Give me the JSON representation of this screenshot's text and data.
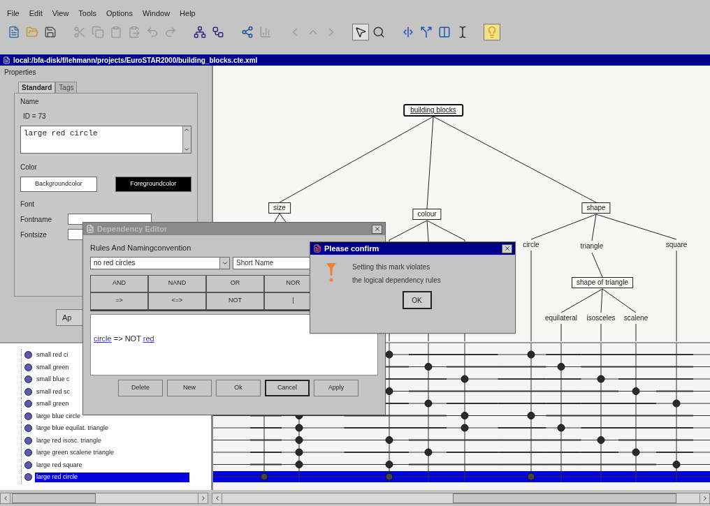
{
  "menu": [
    "File",
    "Edit",
    "View",
    "Tools",
    "Options",
    "Window",
    "Help"
  ],
  "toolbar": [
    [
      {
        "kind": "new",
        "disabled": false,
        "pressed": false
      },
      {
        "kind": "open",
        "disabled": false,
        "pressed": false
      },
      {
        "kind": "save",
        "disabled": false,
        "pressed": false
      }
    ],
    [
      {
        "kind": "cut",
        "disabled": true,
        "pressed": false
      },
      {
        "kind": "copy",
        "disabled": true,
        "pressed": false
      },
      {
        "kind": "paste",
        "disabled": true,
        "pressed": false
      },
      {
        "kind": "paste_special",
        "disabled": true,
        "pressed": false
      },
      {
        "kind": "undo",
        "disabled": true,
        "pressed": false
      },
      {
        "kind": "redo",
        "disabled": true,
        "pressed": false
      }
    ],
    [
      {
        "kind": "tree",
        "disabled": false,
        "pressed": false
      },
      {
        "kind": "tree_outline",
        "disabled": false,
        "pressed": false
      }
    ],
    [
      {
        "kind": "network",
        "disabled": false,
        "pressed": false
      },
      {
        "kind": "chart",
        "disabled": true,
        "pressed": false
      }
    ],
    [
      {
        "kind": "back",
        "disabled": true,
        "pressed": false
      },
      {
        "kind": "up",
        "disabled": true,
        "pressed": false
      },
      {
        "kind": "forward",
        "disabled": true,
        "pressed": false
      }
    ],
    [
      {
        "kind": "pointer",
        "disabled": false,
        "pressed": true
      },
      {
        "kind": "zoom",
        "disabled": false,
        "pressed": false
      }
    ],
    [
      {
        "kind": "h_split",
        "disabled": false,
        "pressed": false
      },
      {
        "kind": "h_split_outline",
        "disabled": false,
        "pressed": false
      },
      {
        "kind": "h_join",
        "disabled": false,
        "pressed": false
      },
      {
        "kind": "text_cursor",
        "disabled": false,
        "pressed": false
      }
    ],
    [
      {
        "kind": "bulb",
        "disabled": false,
        "pressed": true
      }
    ]
  ],
  "document": {
    "title": "local:/bfa-disk/f/lehmann/projects/EuroSTAR2000/building_blocks.cte.xml"
  },
  "properties": {
    "title": "Properties",
    "tabs": [
      {
        "label": "Standard",
        "selected": true
      },
      {
        "label": "Tags",
        "selected": false
      }
    ],
    "name_group": "Name",
    "id": "ID = 73",
    "name_value": "large red circle",
    "color_group": "Color",
    "background_button": "Backgroundcolor",
    "foreground_button": "Foregroundcolor",
    "font_group": "Font",
    "fontname_label": "Fontname",
    "fontsize_label": "Fontsize",
    "apply_button": "Ap"
  },
  "tree": {
    "label": "building blocks",
    "kind": "root",
    "children": [
      {
        "label": "size",
        "kind": "classification"
      },
      {
        "label": "colour",
        "kind": "classification"
      },
      {
        "label": "shape",
        "kind": "classification",
        "children": [
          {
            "label": "circle",
            "kind": "class"
          },
          {
            "label": "triangle",
            "kind": "class",
            "children": [
              {
                "label": "shape of triangle",
                "kind": "classification",
                "children": [
                  {
                    "label": "equilateral",
                    "kind": "class"
                  },
                  {
                    "label": "isosceles",
                    "kind": "class"
                  },
                  {
                    "label": "scalene",
                    "kind": "class"
                  }
                ]
              }
            ]
          },
          {
            "label": "square",
            "kind": "class"
          }
        ]
      }
    ]
  },
  "combinations": [
    {
      "label": "small red ci",
      "selected": false,
      "marks": [
        true,
        false,
        false,
        true,
        false,
        false,
        false,
        false
      ]
    },
    {
      "label": "small green",
      "selected": false,
      "marks": [
        false,
        true,
        false,
        false,
        true,
        false,
        false,
        false
      ]
    },
    {
      "label": "small blue c",
      "selected": false,
      "marks": [
        false,
        false,
        true,
        false,
        false,
        true,
        false,
        false
      ]
    },
    {
      "label": "small red sc",
      "selected": false,
      "marks": [
        true,
        false,
        false,
        false,
        false,
        false,
        true,
        false
      ]
    },
    {
      "label": "small green",
      "selected": false,
      "marks": [
        false,
        true,
        false,
        false,
        false,
        false,
        false,
        true
      ]
    },
    {
      "label": "large blue circle",
      "selected": false,
      "marks": [
        false,
        true,
        false,
        false,
        true,
        true,
        false,
        false,
        false,
        false
      ]
    },
    {
      "label": "large blue equilat. triangle",
      "selected": false,
      "marks": [
        false,
        true,
        false,
        false,
        true,
        false,
        true,
        false,
        false,
        false
      ]
    },
    {
      "label": "large red isosc. triangle",
      "selected": false,
      "marks": [
        false,
        true,
        true,
        false,
        false,
        false,
        false,
        true,
        false,
        false
      ]
    },
    {
      "label": "large green scalene triangle",
      "selected": false,
      "marks": [
        false,
        true,
        false,
        true,
        false,
        false,
        false,
        false,
        true,
        false
      ]
    },
    {
      "label": "large red square",
      "selected": false,
      "marks": [
        false,
        true,
        true,
        false,
        false,
        false,
        false,
        false,
        false,
        true
      ]
    },
    {
      "label": "large red circle",
      "selected": true,
      "marks": [
        true,
        false,
        true,
        false,
        false,
        true,
        false,
        false,
        false,
        false
      ]
    }
  ],
  "dependency_editor": {
    "title": "Dependency Editor",
    "active": false,
    "section": "Rules And Namingconvention",
    "rule_select": "no red circles",
    "short_name": "Short Name",
    "operators": [
      [
        "AND",
        "NAND",
        "OR",
        "NOR"
      ],
      [
        "=>",
        "<=>",
        "NOT",
        "|"
      ]
    ],
    "rule": [
      {
        "kind": "link",
        "text": "circle"
      },
      {
        "kind": "text",
        "text": " => NOT "
      },
      {
        "kind": "link",
        "text": "red"
      }
    ],
    "buttons": [
      {
        "label": "Delete",
        "focused": false
      },
      {
        "label": "New",
        "focused": false
      },
      {
        "label": "Ok",
        "focused": false
      },
      {
        "label": "Cancel",
        "focused": true
      },
      {
        "label": "Apply",
        "focused": false
      }
    ]
  },
  "confirm": {
    "title": "Please confirm",
    "lines": [
      "Setting this mark violates",
      "the logical dependency rules"
    ],
    "button": "OK"
  }
}
